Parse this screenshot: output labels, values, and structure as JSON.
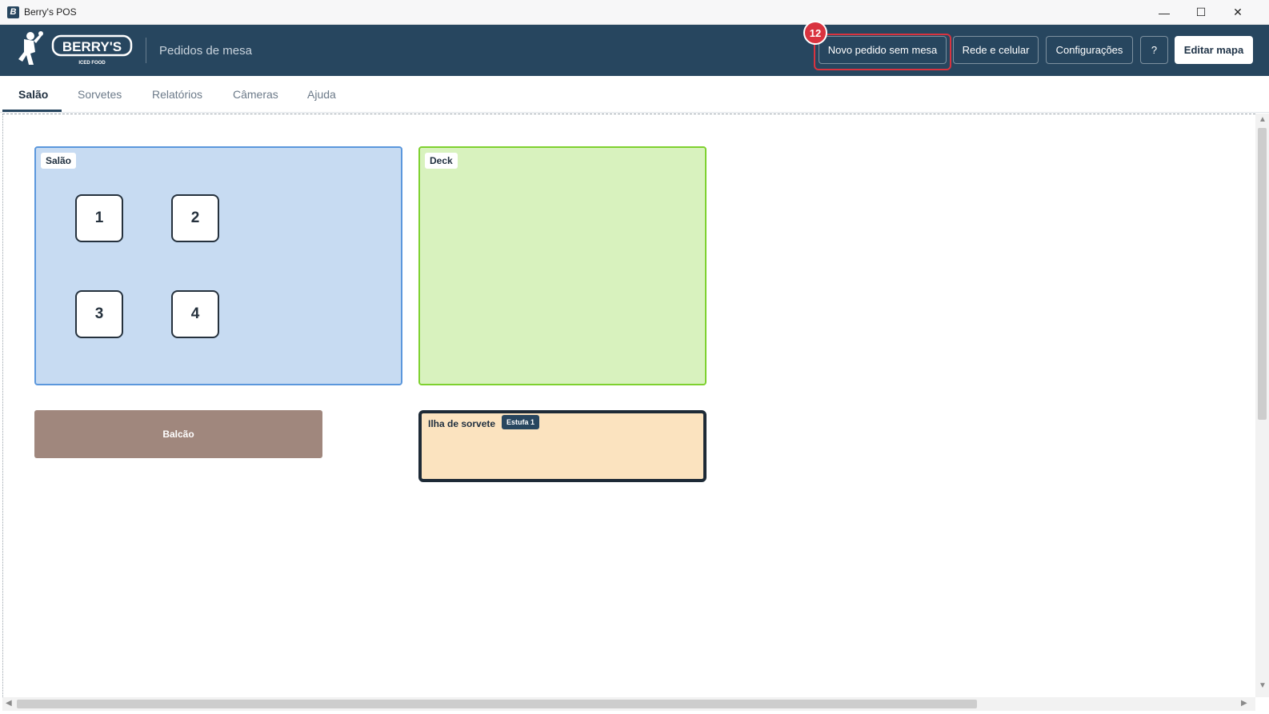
{
  "window": {
    "title": "Berry's POS",
    "minimize_glyph": "—",
    "maximize_glyph": "☐",
    "close_glyph": "✕"
  },
  "header": {
    "logo_text": "BERRY'S",
    "logo_tagline": "ICED FOOD",
    "subtitle": "Pedidos de mesa",
    "buttons": {
      "novo_pedido": "Novo pedido sem mesa",
      "rede": "Rede e celular",
      "config": "Configurações",
      "help": "?",
      "editar": "Editar mapa"
    },
    "step_badge": "12"
  },
  "tabs": [
    {
      "label": "Salão",
      "active": true
    },
    {
      "label": "Sorvetes",
      "active": false
    },
    {
      "label": "Relatórios",
      "active": false
    },
    {
      "label": "Câmeras",
      "active": false
    },
    {
      "label": "Ajuda",
      "active": false
    }
  ],
  "areas": {
    "salao": {
      "label": "Salão",
      "tables": [
        "1",
        "2",
        "3",
        "4"
      ]
    },
    "deck": {
      "label": "Deck"
    },
    "balcao": {
      "label": "Balcão"
    },
    "ilha": {
      "label": "Ilha de sorvete",
      "tag": "Estufa 1"
    }
  },
  "colors": {
    "header_bg": "#27465f",
    "highlight": "#d9333f",
    "salao_bg": "#c7dbf2",
    "deck_bg": "#d8f2be",
    "balcao_bg": "#a0877d",
    "ilha_bg": "#fbe3bf"
  },
  "icons": {
    "app": "app-icon",
    "logo": "berrys-mascot-icon"
  }
}
